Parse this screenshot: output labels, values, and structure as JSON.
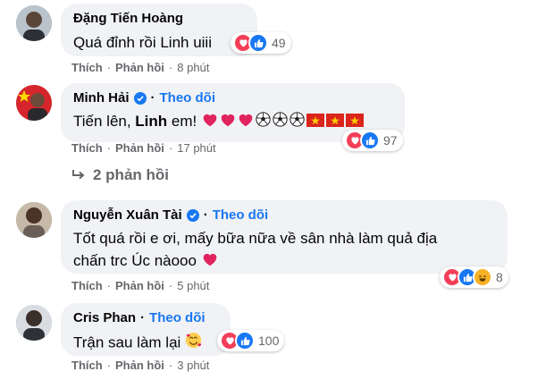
{
  "comments": [
    {
      "name": "Đặng Tiến Hoàng",
      "verified": false,
      "follow": "",
      "text": "Quá đỉnh rồi Linh uiii",
      "reaction_count": "49",
      "actions": {
        "like": "Thích",
        "reply": "Phản hồi",
        "time": "8 phút"
      }
    },
    {
      "name": "Minh Hải",
      "verified": true,
      "follow": "Theo dõi",
      "text_before": "Tiến lên, ",
      "text_bold": "Linh",
      "text_after": " em!",
      "reaction_count": "97",
      "actions": {
        "like": "Thích",
        "reply": "Phản hồi",
        "time": "17 phút"
      }
    },
    {
      "name": "Nguyễn Xuân Tài",
      "verified": true,
      "follow": "Theo dõi",
      "text_line1": "Tốt quá rồi e ơi, mấy bữa nữa về sân nhà làm quả địa",
      "text_line2": "chấn trc Úc nàooo",
      "reaction_count": "8",
      "actions": {
        "like": "Thích",
        "reply": "Phản hồi",
        "time": "5 phút"
      }
    },
    {
      "name": "Cris Phan",
      "verified": false,
      "follow": "Theo dõi",
      "text": "Trận sau làm lại",
      "reaction_count": "100",
      "actions": {
        "like": "Thích",
        "reply": "Phản hồi",
        "time": "3 phút"
      }
    }
  ],
  "replies_link": "2 phản hồi",
  "icons": {
    "reaction_heart": "heart-icon",
    "reaction_like": "like-icon",
    "reaction_haha": "haha-icon",
    "verified": "verified-badge-icon",
    "reply_arrow": "reply-arrow-icon"
  },
  "colors": {
    "bubble": "#f0f2f5",
    "link": "#1877f2",
    "meta": "#65676b",
    "heart": "#f33e58"
  }
}
